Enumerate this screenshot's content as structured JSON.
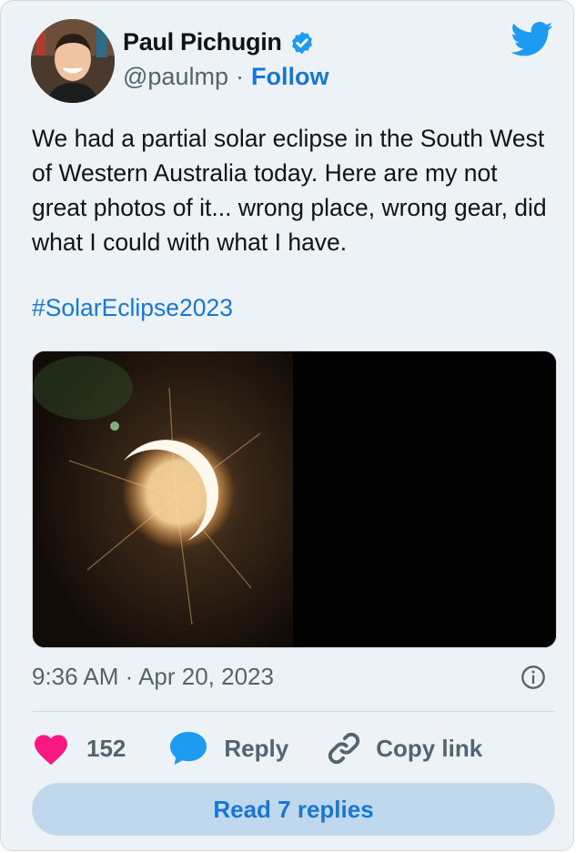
{
  "author": {
    "name": "Paul Pichugin",
    "handle": "@paulmp",
    "separator": "·",
    "follow_label": "Follow"
  },
  "tweet": {
    "text": "We had a partial solar eclipse in the South West of Western Australia today. Here are my not great photos of it... wrong place, wrong gear, did what I could with what I have.",
    "hashtag": "#SolarEclipse2023",
    "timestamp": "9:36 AM · Apr 20, 2023"
  },
  "actions": {
    "like_count": "152",
    "reply_label": "Reply",
    "copy_label": "Copy link"
  },
  "read_replies_label": "Read 7 replies",
  "icons": {
    "verified": "verified-badge-icon",
    "brand": "twitter-bird-icon",
    "info": "info-icon",
    "like": "heart-icon",
    "reply": "speech-bubble-icon",
    "copy": "link-icon"
  },
  "colors": {
    "card_bg": "#edf2f6",
    "link_blue": "#1877d2",
    "twitter_blue": "#1d9bf0",
    "heart": "#f91880",
    "muted": "#536471"
  }
}
